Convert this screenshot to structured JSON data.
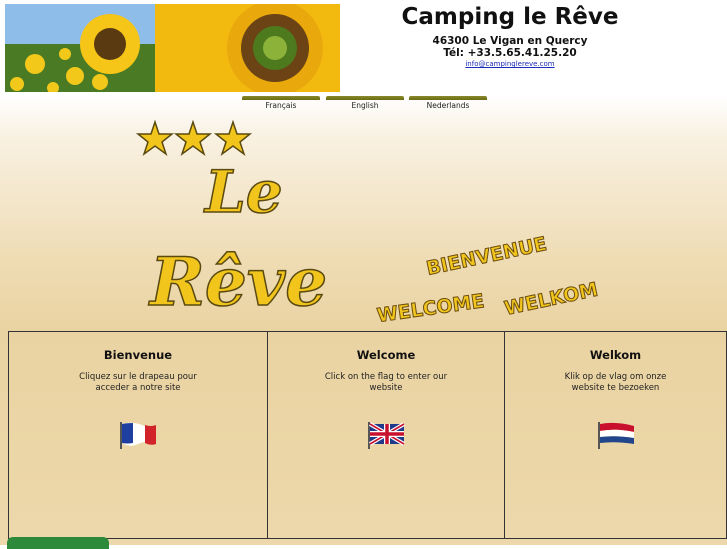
{
  "header": {
    "title": "Camping le Rêve",
    "address": "46300 Le Vigan en Quercy",
    "phone": "Tél: +33.5.65.41.25.20",
    "email": "info@campinglereve.com"
  },
  "tabs": [
    {
      "label": "Français"
    },
    {
      "label": "English"
    },
    {
      "label": "Nederlands"
    }
  ],
  "logo": {
    "stars": 3,
    "line1": "Le",
    "line2": "Rêve"
  },
  "greetings": {
    "french": "BIENVENUE",
    "english": "WELCOME",
    "dutch": "WELKOM"
  },
  "panels": [
    {
      "title": "Bienvenue",
      "text": "Cliquez sur le drapeau pour acceder a notre site",
      "flag": "france-flag-icon"
    },
    {
      "title": "Welcome",
      "text": "Click on the flag to enter our website",
      "flag": "uk-flag-icon"
    },
    {
      "title": "Welkom",
      "text": "Klik op de vlag om onze website te bezoeken",
      "flag": "netherlands-flag-icon"
    }
  ],
  "colors": {
    "title_gold": "#e8c21a",
    "link_blue": "#1a2cb8",
    "tab_olive": "#7a7a1e"
  }
}
